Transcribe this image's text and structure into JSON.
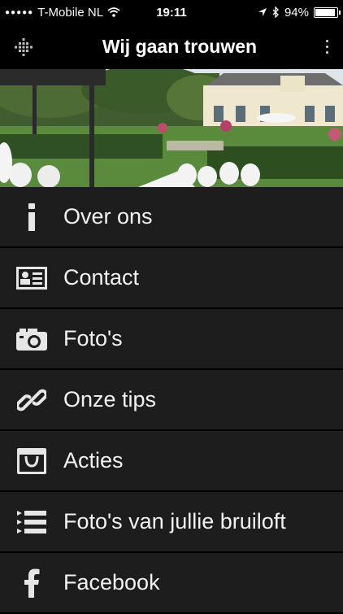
{
  "status_bar": {
    "carrier": "T-Mobile NL",
    "time": "19:11",
    "battery": "94%",
    "battery_level": 0.94
  },
  "navbar": {
    "title": "Wij gaan trouwen",
    "left_icon": "grid-menu-icon",
    "right_icon": "more-vertical-icon"
  },
  "menu": {
    "items": [
      {
        "label": "Over ons",
        "icon": "info-icon"
      },
      {
        "label": "Contact",
        "icon": "contact-card-icon"
      },
      {
        "label": "Foto's",
        "icon": "camera-icon"
      },
      {
        "label": "Onze tips",
        "icon": "link-icon"
      },
      {
        "label": "Acties",
        "icon": "shopping-bag-icon"
      },
      {
        "label": "Foto's van jullie bruiloft",
        "icon": "list-icon"
      },
      {
        "label": "Facebook",
        "icon": "facebook-icon"
      }
    ]
  },
  "colors": {
    "background": "#000000",
    "menu_bg": "#1d1d1d",
    "text": "#f2f2f2"
  }
}
